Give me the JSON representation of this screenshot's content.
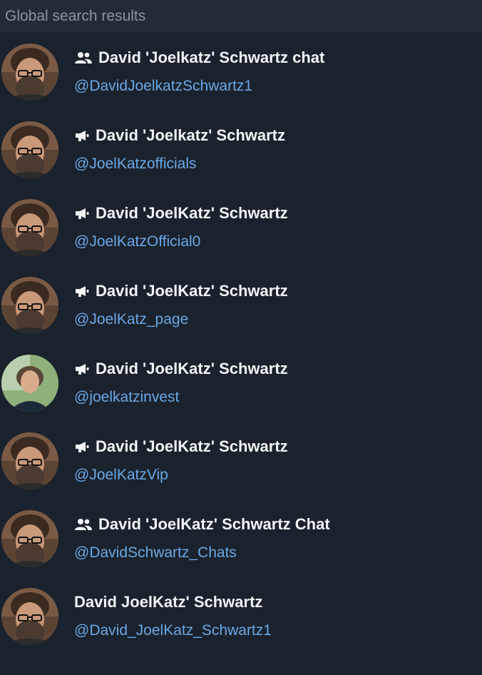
{
  "header": {
    "title": "Global search results"
  },
  "colors": {
    "background": "#1a222d",
    "header_bg": "#232b36",
    "username": "#6aa8e6",
    "title": "#f2f4f6"
  },
  "results": [
    {
      "type": "group",
      "type_icon": "group-icon",
      "title": "David 'Joelkatz' Schwartz chat",
      "username": "@DavidJoelkatzSchwartz1",
      "avatar": "bearded-man"
    },
    {
      "type": "channel",
      "type_icon": "megaphone-icon",
      "title": "David 'Joelkatz' Schwartz",
      "username": "@JoelKatzofficials",
      "avatar": "bearded-man"
    },
    {
      "type": "channel",
      "type_icon": "megaphone-icon",
      "title": "David 'JoelKatz' Schwartz",
      "username": "@JoelKatzOfficial0",
      "avatar": "bearded-man"
    },
    {
      "type": "channel",
      "type_icon": "megaphone-icon",
      "title": "David 'JoelKatz' Schwartz",
      "username": "@JoelKatz_page",
      "avatar": "bearded-man"
    },
    {
      "type": "channel",
      "type_icon": "megaphone-icon",
      "title": "David 'JoelKatz' Schwartz",
      "username": "@joelkatzinvest",
      "avatar": "man-outdoors"
    },
    {
      "type": "channel",
      "type_icon": "megaphone-icon",
      "title": "David 'JoelKatz' Schwartz",
      "username": "@JoelKatzVip",
      "avatar": "bearded-man"
    },
    {
      "type": "group",
      "type_icon": "group-icon",
      "title": "David 'JoelKatz' Schwartz Chat",
      "username": "@DavidSchwartz_Chats",
      "avatar": "bearded-man"
    },
    {
      "type": "user",
      "type_icon": "",
      "title": "David JoelKatz' Schwartz",
      "username": "@David_JoelKatz_Schwartz1",
      "avatar": "bearded-man"
    }
  ]
}
